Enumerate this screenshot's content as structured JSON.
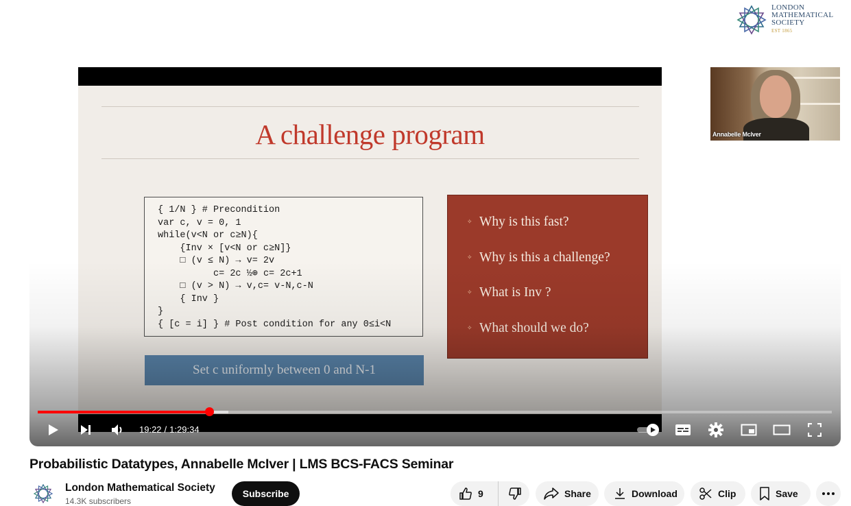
{
  "video": {
    "title": "Probabilistic Datatypes, Annabelle McIver | LMS BCS-FACS Seminar",
    "time_current": "19:22",
    "time_separator": "/",
    "time_total": "1:29:34",
    "progress": {
      "played_fraction": 0.2163,
      "loaded_fraction": 0.24
    }
  },
  "overlay": {
    "org_lines": [
      "LONDON",
      "MATHEMATICAL",
      "SOCIETY"
    ],
    "org_est": "EST 1865",
    "speaker_label": "Annabelle McIver"
  },
  "slide": {
    "title": "A challenge program",
    "code_lines": [
      "{ 1/N } # Precondition",
      "var c, v = 0, 1",
      "while(v<N or c≥N){",
      "    {Inv × [v<N or c≥N]}",
      "    □ (v ≤ N) → v= 2v",
      "          c= 2c ½⊕ c= 2c+1",
      "    □ (v > N) → v,c= v-N,c-N",
      "    { Inv }",
      "}",
      "{ [c = i] } # Post condition for any 0≤i<N"
    ],
    "questions": [
      "Why is this fast?",
      "Why is this a challenge?",
      "What is Inv ?",
      "What should we do?"
    ],
    "banner": "Set c uniformly between 0 and N-1"
  },
  "controls": {
    "icons": [
      "play-icon",
      "next-icon",
      "volume-icon",
      "autoplay-toggle",
      "subtitles-icon",
      "settings-icon",
      "miniplayer-icon",
      "theater-icon",
      "fullscreen-icon"
    ]
  },
  "channel": {
    "name": "London Mathematical Society",
    "subscribers": "14.3K subscribers",
    "subscribe_label": "Subscribe"
  },
  "actions": {
    "like_count": "9",
    "share_label": "Share",
    "download_label": "Download",
    "clip_label": "Clip",
    "save_label": "Save"
  },
  "colors": {
    "progress_played": "#ff0000",
    "slide_title": "#c0392b",
    "question_box": "#9b3a2a",
    "banner": "#5b86ad",
    "lms_logo": "#2d4a6b"
  }
}
